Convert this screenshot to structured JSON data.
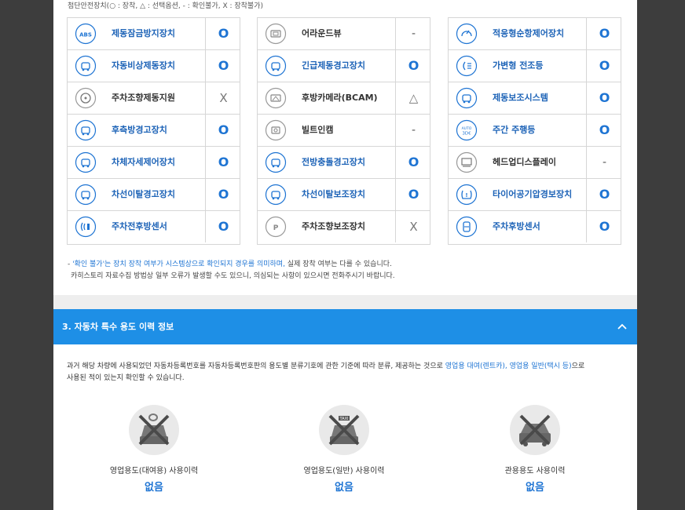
{
  "legend": "첨단안전장치(○ : 장착, △ : 선택옵션, - : 확인불가, X : 장착불가)",
  "colors": {
    "accent": "#1e8fe6",
    "blue_text": "#1d63b7",
    "o_mark": "#1e74d3",
    "border": "#d6d6d6"
  },
  "columns": [
    {
      "items": [
        {
          "label": "제동잠금방지장치",
          "status": "O",
          "icon": "abs-icon",
          "label_color": "blue"
        },
        {
          "label": "자동비상제동장치",
          "status": "O",
          "icon": "emergency-brake-icon",
          "label_color": "blue"
        },
        {
          "label": "주차조향제동지원",
          "status": "X",
          "icon": "steering-wheel-icon",
          "label_color": "dark"
        },
        {
          "label": "후측방경고장치",
          "status": "O",
          "icon": "rear-side-warning-icon",
          "label_color": "blue"
        },
        {
          "label": "차체자세제어장치",
          "status": "O",
          "icon": "stability-control-icon",
          "label_color": "blue"
        },
        {
          "label": "차선이탈경고장치",
          "status": "O",
          "icon": "lane-departure-icon",
          "label_color": "blue"
        },
        {
          "label": "주차전후방센서",
          "status": "O",
          "icon": "parking-sensor-icon",
          "label_color": "blue"
        }
      ]
    },
    {
      "items": [
        {
          "label": "어라운드뷰",
          "status": "-",
          "icon": "around-view-icon",
          "label_color": "dark"
        },
        {
          "label": "긴급제동경고장치",
          "status": "O",
          "icon": "emergency-warning-icon",
          "label_color": "blue"
        },
        {
          "label": "후방카메라(BCAM)",
          "status": "△",
          "icon": "rear-camera-icon",
          "label_color": "dark"
        },
        {
          "label": "빌트인캠",
          "status": "-",
          "icon": "builtin-cam-icon",
          "label_color": "dark"
        },
        {
          "label": "전방충돌경고장치",
          "status": "O",
          "icon": "forward-collision-icon",
          "label_color": "blue"
        },
        {
          "label": "차선이탈보조장치",
          "status": "O",
          "icon": "lane-keep-assist-icon",
          "label_color": "blue"
        },
        {
          "label": "주차조향보조장치",
          "status": "X",
          "icon": "parking-assist-icon",
          "label_color": "dark"
        }
      ]
    },
    {
      "items": [
        {
          "label": "적응형순항제어장치",
          "status": "O",
          "icon": "cruise-control-icon",
          "label_color": "blue"
        },
        {
          "label": "가변형 전조등",
          "status": "O",
          "icon": "adaptive-headlight-icon",
          "label_color": "blue"
        },
        {
          "label": "제동보조시스템",
          "status": "O",
          "icon": "brake-assist-icon",
          "label_color": "blue"
        },
        {
          "label": "주간 주행등",
          "status": "O",
          "icon": "daytime-light-icon",
          "label_color": "blue"
        },
        {
          "label": "헤드업디스플레이",
          "status": "-",
          "icon": "hud-icon",
          "label_color": "dark"
        },
        {
          "label": "타이어공기압경보장치",
          "status": "O",
          "icon": "tire-pressure-icon",
          "label_color": "blue"
        },
        {
          "label": "주차후방센서",
          "status": "O",
          "icon": "rear-sensor-icon",
          "label_color": "blue"
        }
      ]
    }
  ],
  "note": {
    "prefix": "- ",
    "highlight": "'확인 불가'는 장치 장착 여부가 시스템상으로 확인되지 경우를 의미하며,",
    "rest": " 실제 장착 여부는 다를 수 있습니다.",
    "line2": "카히스토리 자료수집 방법상 일부 오류가 발생할 수도 있으니, 의심되는 사항이 있으시면 전화주시기 바랍니다."
  },
  "section3": {
    "title": "3. 자동차 특수 용도 이력 정보",
    "desc_line1_a": "과거 해당 차량에 사용되었던 자동차등록번호를 자동차등록번호판의 용도별 분류기호에 관한 기준에 따라 분류, 제공하는 것으로 ",
    "desc_line1_hl": "영업용 대여(렌트카), 영업용 일반(택시 등)",
    "desc_line1_b": "으로",
    "desc_line2": "사용된 적이 있는지 확인할 수 있습니다.",
    "usages": [
      {
        "label": "영업용도(대여용) 사용이력",
        "value": "없음",
        "icon": "rental-car-crossed-icon"
      },
      {
        "label": "영업용도(일반) 사용이력",
        "value": "없음",
        "icon": "taxi-crossed-icon"
      },
      {
        "label": "관용용도 사용이력",
        "value": "없음",
        "icon": "government-car-crossed-icon"
      }
    ]
  }
}
